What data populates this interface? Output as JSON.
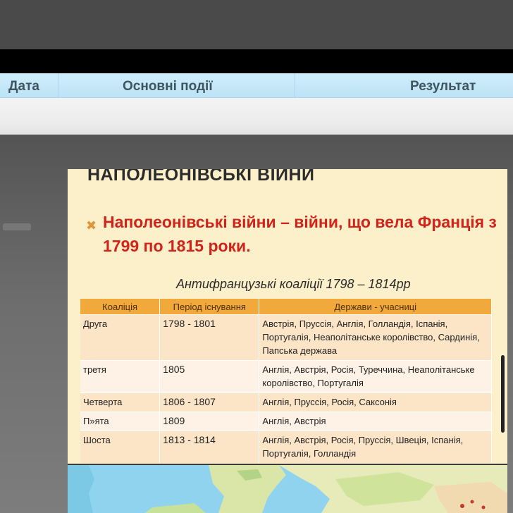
{
  "background_table": {
    "headers": [
      "Дата",
      "Основні події",
      "Результат"
    ]
  },
  "slide": {
    "title": "НАПОЛЕОНІВСЬКІ ВІЙНИ",
    "bullet": "Наполеонівські війни – війни, що вела Франція з 1799 по 1815 роки.",
    "caption": "Антифранцузькі коаліції 1798 – 1814рр",
    "table": {
      "headers": [
        "Коаліція",
        "Період існування",
        "Держави - учасниці"
      ],
      "rows": [
        {
          "coalition": "Друга",
          "period": "1798 - 1801",
          "states": "Австрія, Пруссія, Англія, Голландія, Іспанія, Португалія, Неаполітанське королівство, Сардинія, Папська держава"
        },
        {
          "coalition": "третя",
          "period": "1805",
          "states": "Англія, Австрія, Росія, Туреччина, Неаполітанське королівство, Португалія"
        },
        {
          "coalition": "Четверта",
          "period": "1806 - 1807",
          "states": "Англія, Пруссія, Росія, Саксонія"
        },
        {
          "coalition": "П»ята",
          "period": "1809",
          "states": "Англія, Австрія"
        },
        {
          "coalition": "Шоста",
          "period": "1813 - 1814",
          "states": "Англія, Австрія, Росія, Пруссія, Швеція, Іспанія, Португалія, Голландія"
        }
      ]
    }
  },
  "colors": {
    "slide_bg": "#fbf0c9",
    "bullet_text": "#d2231b",
    "table_header": "#f2a93b",
    "row_odd": "#fce4c7",
    "row_even": "#fdf2e5",
    "strip_header": "#bde3f6"
  }
}
